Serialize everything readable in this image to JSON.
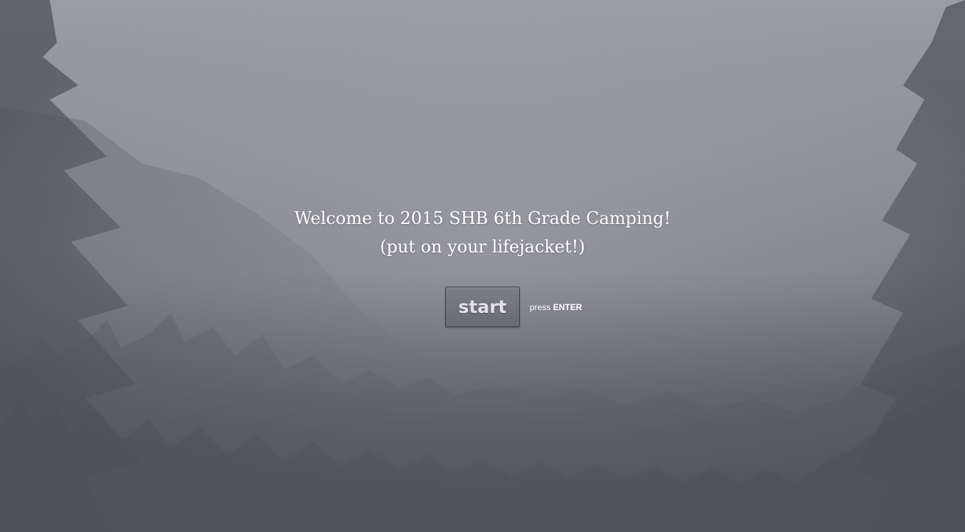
{
  "welcome": {
    "line1": "Welcome to 2015 SHB 6th Grade Camping!",
    "line2": "(put on your lifejacket!)"
  },
  "start": {
    "label": "start"
  },
  "hint": {
    "prefix": "press",
    "key": "ENTER"
  },
  "colors": {
    "fog": "#8e8f99",
    "forest": "#51525d",
    "text": "#ffffff"
  }
}
